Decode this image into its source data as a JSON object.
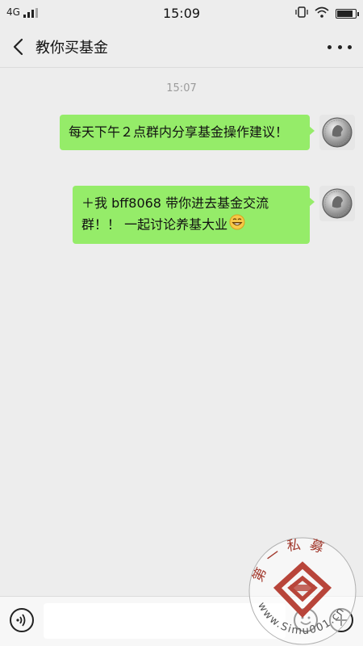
{
  "status_bar": {
    "network": "4G",
    "time": "15:09",
    "battery_level": 0.9
  },
  "nav": {
    "title": "教你买基金",
    "back_icon": "chevron-left-icon",
    "more_icon": "more-dots-icon"
  },
  "chat": {
    "timestamp": "15:07",
    "messages": [
      {
        "text": "每天下午２点群内分享基金操作建议！",
        "sender": "self"
      },
      {
        "text": "＋我  bff8068 带你进去基金交流群！！ 一起讨论养基大业",
        "sender": "self",
        "emoji": "grin-emoji"
      }
    ]
  },
  "input_bar": {
    "voice_icon": "voice-icon",
    "emoji_icon": "smile-icon",
    "plus_icon": "plus-icon"
  },
  "watermark": {
    "text": "第一私募",
    "url": "www.Simu001.cn"
  },
  "colors": {
    "background": "#ededed",
    "bubble": "#95ec69",
    "accent_red": "#c0392b"
  }
}
